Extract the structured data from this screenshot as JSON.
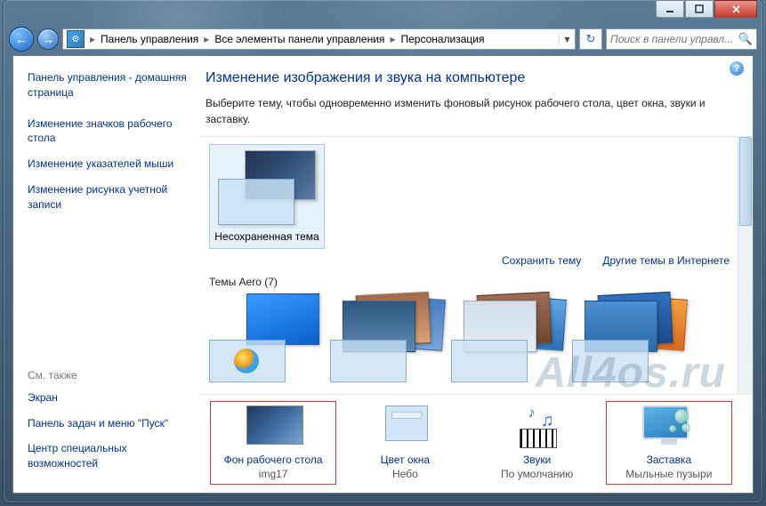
{
  "breadcrumb": {
    "items": [
      "Панель управления",
      "Все элементы панели управления",
      "Персонализация"
    ]
  },
  "search": {
    "placeholder": "Поиск в панели управл..."
  },
  "sidebar": {
    "home": "Панель управления - домашняя страница",
    "links": [
      "Изменение значков рабочего стола",
      "Изменение указателей мыши",
      "Изменение рисунка учетной записи"
    ],
    "see_also_heading": "См. также",
    "see_also": [
      "Экран",
      "Панель задач и меню \"Пуск\"",
      "Центр специальных возможностей"
    ]
  },
  "main": {
    "title": "Изменение изображения и звука на компьютере",
    "description": "Выберите тему, чтобы одновременно изменить фоновый рисунок рабочего стола, цвет окна, звуки и заставку.",
    "my_themes": {
      "item_label": "Несохраненная тема"
    },
    "links": {
      "save": "Сохранить тему",
      "online": "Другие темы в Интернете"
    },
    "aero_heading": "Темы Aero (7)"
  },
  "bottom": {
    "items": [
      {
        "title": "Фон рабочего стола",
        "sub": "img17"
      },
      {
        "title": "Цвет окна",
        "sub": "Небо"
      },
      {
        "title": "Звуки",
        "sub": "По умолчанию"
      },
      {
        "title": "Заставка",
        "sub": "Мыльные пузыри"
      }
    ]
  },
  "watermark": "All4os.ru"
}
